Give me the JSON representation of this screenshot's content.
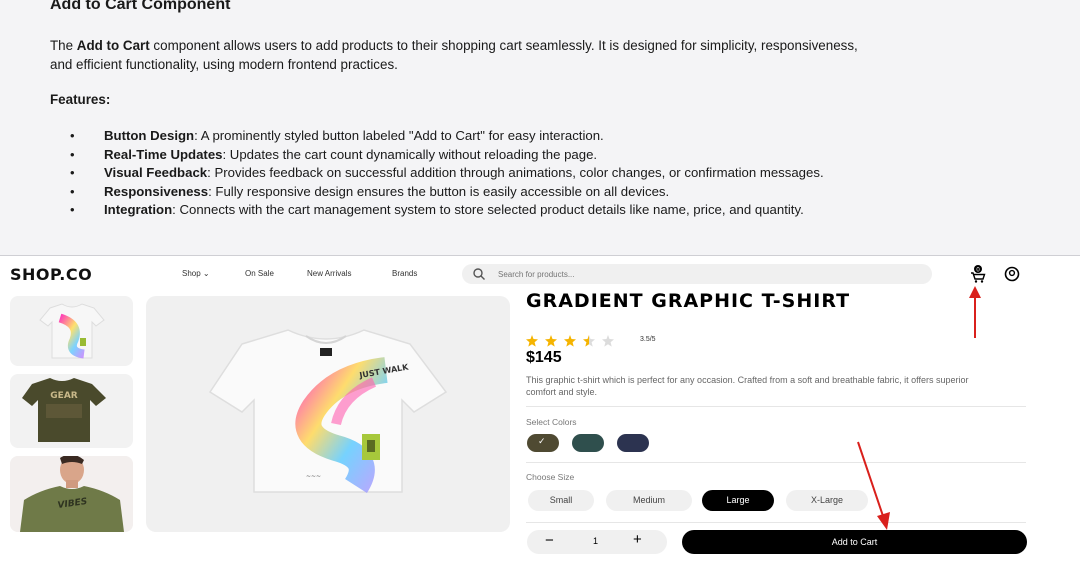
{
  "doc": {
    "title": "Add to Cart Component",
    "intro_prefix": "The ",
    "intro_bold": "Add to Cart",
    "intro_rest": " component allows users to add products to their shopping cart seamlessly. It is designed for simplicity, responsiveness, and efficient functionality, using modern frontend practices.",
    "features_heading": "Features:",
    "features": [
      {
        "term": "Button Design",
        "text": ": A prominently styled button labeled \"Add to Cart\" for easy interaction."
      },
      {
        "term": "Real-Time Updates",
        "text": ": Updates the cart count dynamically without reloading the page."
      },
      {
        "term": "Visual Feedback",
        "text": ": Provides feedback on successful addition through animations, color changes, or confirmation messages."
      },
      {
        "term": "Responsiveness",
        "text": ": Fully responsive design ensures the button is easily accessible on all devices."
      },
      {
        "term": "Integration",
        "text": ": Connects with the cart management system to store selected product details like name, price, and quantity."
      }
    ]
  },
  "shop": {
    "logo": "SHOP.CO",
    "nav": {
      "shop": "Shop ⌄",
      "on_sale": "On Sale",
      "new_arrivals": "New Arrivals",
      "brands": "Brands"
    },
    "search_placeholder": "Search for products...",
    "cart_count": "0",
    "icons": {
      "search": "search-icon",
      "cart": "cart-icon",
      "user": "user-icon"
    }
  },
  "product": {
    "title": "GRADIENT GRAPHIC T-SHIRT",
    "rating_value": 3.5,
    "rating_max": 5,
    "rating_text": "3.5/5",
    "price": "$145",
    "description": "This graphic t-shirt which is perfect for any occasion. Crafted from a soft and breathable fabric, it offers superior comfort and style.",
    "colors_label": "Select Colors",
    "colors": [
      {
        "name": "olive",
        "hex": "#4f4a32",
        "selected": true
      },
      {
        "name": "teal",
        "hex": "#2f4f4d",
        "selected": false
      },
      {
        "name": "navy",
        "hex": "#2c3350",
        "selected": false
      }
    ],
    "size_label": "Choose Size",
    "sizes": [
      {
        "label": "Small",
        "active": false
      },
      {
        "label": "Medium",
        "active": false
      },
      {
        "label": "Large",
        "active": true
      },
      {
        "label": "X-Large",
        "active": false
      }
    ],
    "quantity": "1",
    "minus": "−",
    "plus": "+",
    "add_to_cart": "Add to Cart",
    "thumb_text": "GEAR"
  },
  "annotation_color": "#d9201c"
}
